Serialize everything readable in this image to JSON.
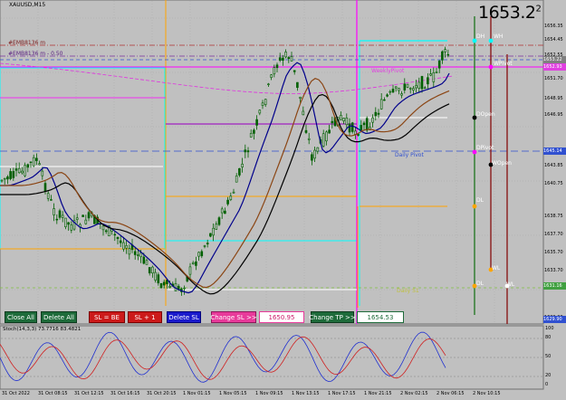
{
  "symbol_label": "XAUUSD,M15",
  "big_price": "1653.2",
  "big_price_sup": "2",
  "indicator_lines": [
    {
      "label": "#EMB8136 m",
      "color": "#9a2020"
    },
    {
      "label": "#EMB8136 m - 0.50",
      "color": "#7a30a0"
    }
  ],
  "price_axis": [
    "1656.35",
    "1654.45",
    "1652.55",
    "1651.70",
    "1648.95",
    "1646.95",
    "1643.85",
    "1640.75",
    "1638.75",
    "1637.70",
    "1635.70",
    "1633.70",
    "1631.70",
    "1629.90"
  ],
  "price_tags": [
    {
      "text": "1653.22",
      "color": "#808080",
      "text_color": "#ffffff"
    },
    {
      "text": "1652.93",
      "color": "#e040e0",
      "text_color": "#ffffff"
    },
    {
      "text": "1645.14",
      "color": "#3050d0",
      "text_color": "#ffffff"
    },
    {
      "text": "1631.16",
      "color": "#40a040",
      "text_color": "#ffffff"
    },
    {
      "text": "1629.90",
      "color": "#3050d0",
      "text_color": "#ffffff"
    }
  ],
  "level_labels": {
    "dh": "DH",
    "wh": "WH",
    "wpivot": "WPivot",
    "dopen": "DOpen",
    "dpivot": "DPivot",
    "wopen": "WOpen",
    "dl": "DL",
    "wl": "WL",
    "dl_low": "DL",
    "weekly_low": "WL",
    "weekly_pivot": "WeeklyPivot",
    "daily_pivot": "Daily Pivot",
    "daily_s1": "Daily S1"
  },
  "buttons": {
    "close_all": "Close All",
    "delete_all": "Delete All",
    "sl_be": "SL = BE",
    "sl_plus": "SL + 1",
    "delete_sl": "Delete SL",
    "change_sl": "Change SL >>",
    "sl_value": "1650.95",
    "change_tp": "Change TP >>",
    "tp_value": "1654.53"
  },
  "osc": {
    "label": "Stoch(14,3,3) 73.7716 83.4821",
    "axis": [
      "100",
      "80",
      "50",
      "20",
      "0"
    ]
  },
  "time_axis": [
    "31 Oct 2022",
    "31 Oct 08:15",
    "31 Oct 12:15",
    "31 Oct 16:15",
    "31 Oct 20:15",
    "1 Nov 01:15",
    "1 Nov 05:15",
    "1 Nov 09:15",
    "1 Nov 13:15",
    "1 Nov 17:15",
    "1 Nov 21:15",
    "2 Nov 02:15",
    "2 Nov 06:15",
    "2 Nov 10:15"
  ],
  "colors": {
    "bg": "#c0c0c0",
    "grid": "#9a9a9a",
    "candle": "#006000",
    "ma_blue": "#00008b",
    "ma_black": "#000000",
    "ma_brown": "#8b4513",
    "magenta": "#ff00ff",
    "cyan": "#00ffff",
    "orange": "#ffa500"
  }
}
